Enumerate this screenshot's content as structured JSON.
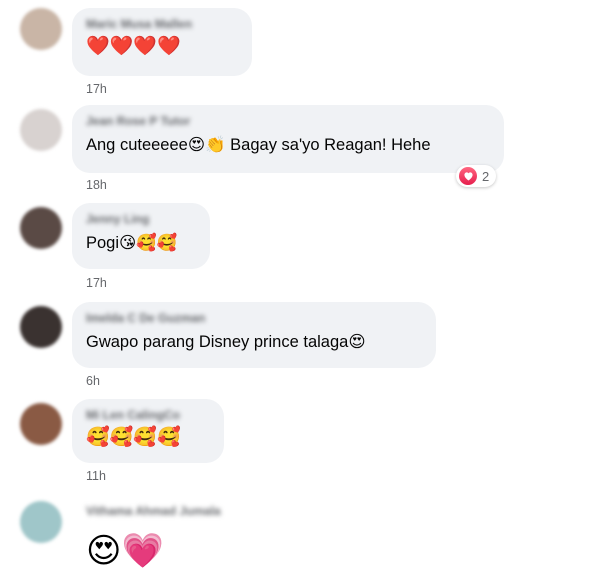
{
  "comments": [
    {
      "author": "Maric Musa Mallen",
      "text": "❤️❤️❤️❤️",
      "time": "17h",
      "avatar_color": "#c9b5a6"
    },
    {
      "author": "Jean Rose P Tutor",
      "text": "Ang cuteeeee😍👏 Bagay sa'yo Reagan! Hehe",
      "time": "18h",
      "reaction_icon": "heart-icon",
      "reaction_count": "2",
      "avatar_color": "#d8d2d0"
    },
    {
      "author": "Jenny Ling",
      "text": "Pogi😘🥰🥰",
      "time": "17h",
      "avatar_color": "#5a4a45"
    },
    {
      "author": "Imelda C De Guzman",
      "text": "Gwapo parang Disney prince talaga😍",
      "time": "6h",
      "avatar_color": "#3a3230"
    },
    {
      "author": "Mi Len CalingCo",
      "text": "🥰🥰🥰🥰",
      "time": "11h",
      "avatar_color": "#8a5a44"
    },
    {
      "author": "Vithama Ahmad Jumala",
      "text": "😍💗",
      "time": "",
      "avatar_color": "#9fc6c9"
    }
  ],
  "colors": {
    "bubble_bg": "#f0f2f5",
    "meta_text": "#65676b",
    "body_text": "#050505",
    "heart": "#e61e4d"
  }
}
